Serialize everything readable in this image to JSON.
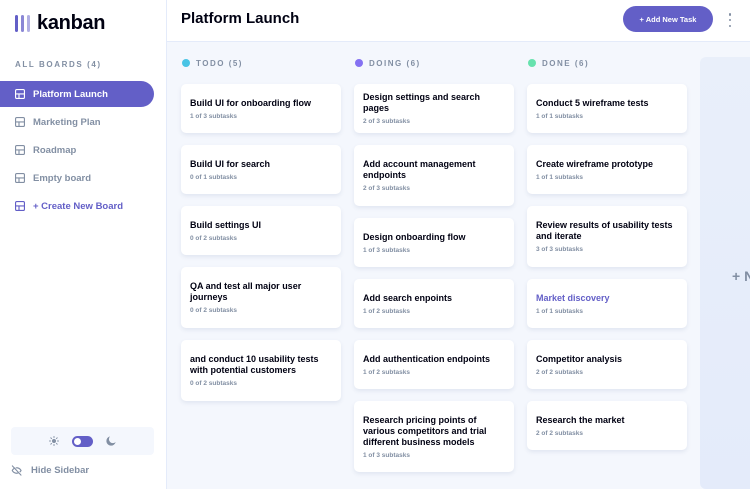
{
  "app": {
    "name": "kanban"
  },
  "sidebar": {
    "heading": "ALL BOARDS (4)",
    "boards": [
      {
        "label": "Platform Launch"
      },
      {
        "label": "Marketing Plan"
      },
      {
        "label": "Roadmap"
      },
      {
        "label": "Empty board"
      }
    ],
    "create_label": "+ Create New Board",
    "hide_label": "Hide Sidebar"
  },
  "header": {
    "title": "Platform Launch",
    "add_task_label": "+ Add New Task"
  },
  "columns": [
    {
      "name": "TODO (5)",
      "color": "#49c4e5",
      "tasks": [
        {
          "title": "Build UI for onboarding flow",
          "subtasks": "1 of 3 subtasks"
        },
        {
          "title": "Build UI for search",
          "subtasks": "0 of 1 subtasks"
        },
        {
          "title": "Build settings UI",
          "subtasks": "0 of 2 subtasks"
        },
        {
          "title": "QA and test all major user journeys",
          "subtasks": "0 of 2 subtasks"
        },
        {
          "title": "and conduct 10 usability tests with potential customers",
          "subtasks": "0 of 2 subtasks"
        }
      ]
    },
    {
      "name": "DOING (6)",
      "color": "#8471f2",
      "tasks": [
        {
          "title": "Design settings and search pages",
          "subtasks": "2 of 3 subtasks"
        },
        {
          "title": "Add account management endpoints",
          "subtasks": "2 of 3 subtasks"
        },
        {
          "title": "Design onboarding flow",
          "subtasks": "1 of 3 subtasks"
        },
        {
          "title": "Add search enpoints",
          "subtasks": "1 of 2 subtasks"
        },
        {
          "title": "Add authentication endpoints",
          "subtasks": "1 of 2 subtasks"
        },
        {
          "title": "Research pricing points of various competitors and trial different business models",
          "subtasks": "1 of 3 subtasks"
        }
      ]
    },
    {
      "name": "DONE (6)",
      "color": "#67e2ae",
      "tasks": [
        {
          "title": "Conduct 5 wireframe tests",
          "subtasks": "1 of 1 subtasks"
        },
        {
          "title": "Create wireframe prototype",
          "subtasks": "1 of 1 subtasks"
        },
        {
          "title": "Review results of usability tests and iterate",
          "subtasks": "3 of 3 subtasks"
        },
        {
          "title": "Market discovery",
          "subtasks": "1 of 1 subtasks"
        },
        {
          "title": "Competitor analysis",
          "subtasks": "2 of 2 subtasks"
        },
        {
          "title": "Research the market",
          "subtasks": "2 of 2 subtasks"
        }
      ]
    }
  ],
  "new_column_label": "+ N",
  "icons": {
    "board": "board-icon",
    "sun": "sun-icon",
    "moon": "moon-icon",
    "hide": "eye-slash-icon",
    "menu": "vertical-ellipsis-icon"
  },
  "colors": {
    "accent": "#635fc7",
    "background": "#f4f7fd",
    "muted": "#828fa3"
  }
}
